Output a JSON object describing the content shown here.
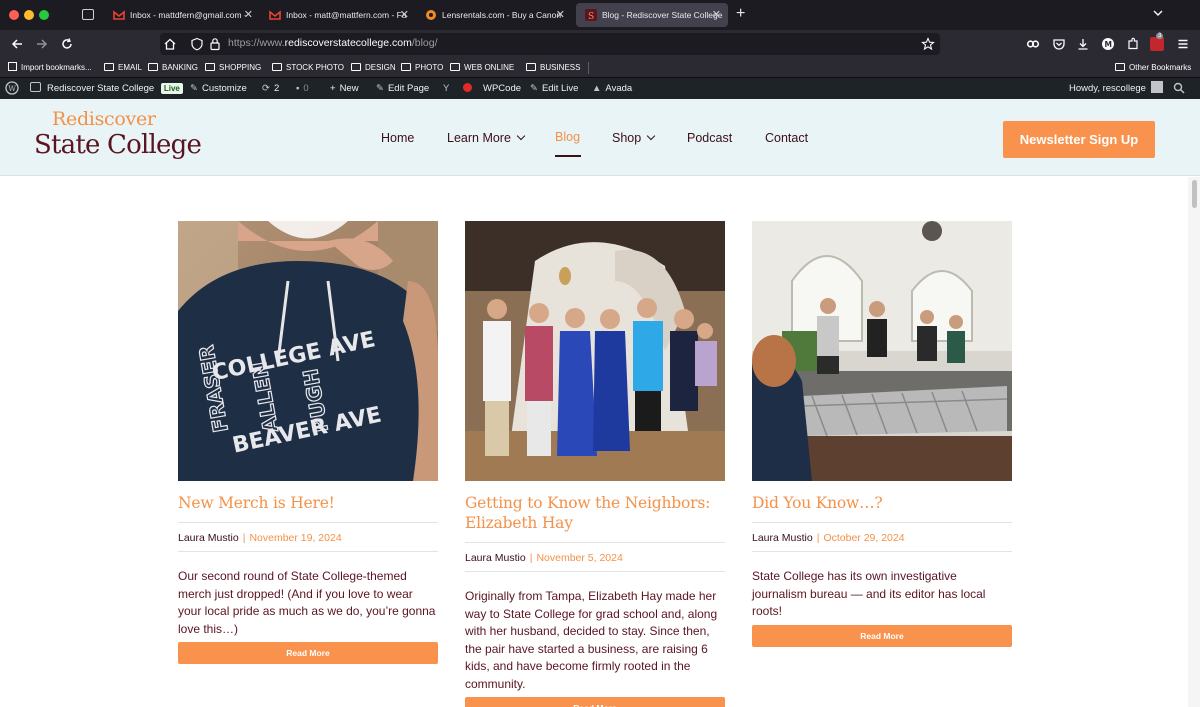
{
  "browser": {
    "tabs": [
      {
        "title": "Inbox - mattdfern@gmail.com -",
        "favicon": "gmail-icon"
      },
      {
        "title": "Inbox - matt@mattfern.com - Fa",
        "favicon": "gmail-icon"
      },
      {
        "title": "Lensrentals.com - Buy a Canon",
        "favicon": "lensrentals-icon"
      },
      {
        "title": "Blog - Rediscover State College",
        "favicon": "site-icon",
        "active": true
      }
    ],
    "url_prefix": "https://www.",
    "url_host": "rediscoverstatecollege.com",
    "url_path": "/blog/",
    "extension_badge": "3",
    "bookmarks": [
      "Import bookmarks...",
      "EMAIL",
      "BANKING",
      "SHOPPING",
      "STOCK PHOTO",
      "DESIGN",
      "PHOTO",
      "WEB ONLINE",
      "BUSINESS"
    ],
    "other_bookmarks": "Other Bookmarks"
  },
  "admin_bar": {
    "site_name": "Rediscover State College",
    "live_badge": "Live",
    "customize": "Customize",
    "updates_count": "2",
    "comments_count": "0",
    "new_label": "New",
    "edit_page": "Edit Page",
    "wpcode": "WPCode",
    "edit_live": "Edit Live",
    "avada": "Avada",
    "greeting": "Howdy, rescollege"
  },
  "site": {
    "logo_line1": "Rediscover",
    "logo_line2": "State College",
    "menu": [
      "Home",
      "Learn More",
      "Blog",
      "Shop",
      "Podcast",
      "Contact"
    ],
    "cta": "Newsletter Sign Up"
  },
  "posts": [
    {
      "title": "New Merch is Here!",
      "author": "Laura Mustio",
      "date": "November 19, 2024",
      "excerpt": "Our second round of State College-themed merch just dropped! (And if you love to wear your local pride as much as we do, you’re gonna love this…)",
      "button": "Read More",
      "hoodie_line1": "COLLEGE AVE",
      "hoodie_line2": "FRASER",
      "hoodie_line3": "ALLEN",
      "hoodie_line4": "PUGH",
      "hoodie_line5": "BEAVER AVE"
    },
    {
      "title": "Getting to Know the Neighbors: Elizabeth Hay",
      "author": "Laura Mustio",
      "date": "November 5, 2024",
      "excerpt": "Originally from Tampa, Elizabeth Hay made her way to State College for grad school and, along with her husband, decided to stay. Since then, the pair have started a business, are raising 6 kids, and have become firmly rooted in the community.",
      "button": "Read More"
    },
    {
      "title": "Did You Know…?",
      "author": "Laura Mustio",
      "date": "October 29, 2024",
      "excerpt": "State College has its own investigative journalism bureau — and its editor has local roots!",
      "button": "Read More"
    }
  ],
  "colors": {
    "accent": "#f9924c",
    "brand_dark": "#5a1422",
    "header_bg": "#e8f4f5"
  }
}
